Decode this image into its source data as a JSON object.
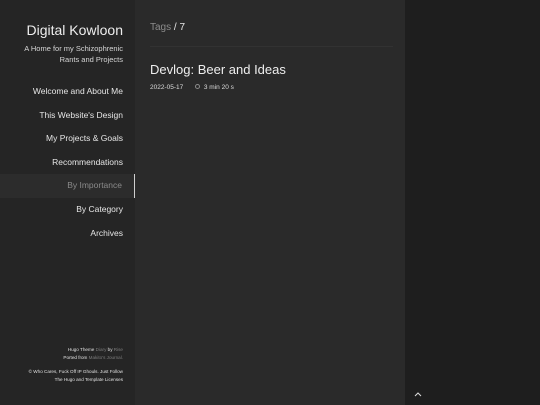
{
  "site": {
    "title": "Digital Kowloon",
    "subtitle": "A Home for my Schizophrenic Rants and Projects"
  },
  "nav": {
    "items": [
      {
        "label": "Welcome and About Me"
      },
      {
        "label": "This Website's Design"
      },
      {
        "label": "My Projects & Goals"
      },
      {
        "label": "Recommendations"
      },
      {
        "label": "By Importance"
      },
      {
        "label": "By Category"
      },
      {
        "label": "Archives"
      }
    ],
    "active_label": "By Importance"
  },
  "footer": {
    "theme_prefix": "Hugo Theme",
    "theme_name": "Diary",
    "theme_by": "by",
    "theme_author": "Rise",
    "ported_prefix": "Ported from",
    "ported_source": "Makito's Journal.",
    "license_line1": "© Who Cares, Fuck Off IP Ghouls. Just Follow",
    "license_line2": "The Hugo and Template Licenses"
  },
  "page": {
    "header_prefix": "Tags",
    "header_separator": "/",
    "header_count": "7"
  },
  "posts": [
    {
      "title": "Devlog: Beer and Ideas",
      "date": "2022-05-17",
      "reading_time": "3 min 20 s"
    }
  ],
  "icons": {
    "reading_time": "clock-icon",
    "back_to_top": "chevron-up-icon"
  },
  "colors": {
    "background": "#1e1e1e",
    "sidebar": "#252525",
    "main": "#2a2a2a",
    "text": "#eeeeee",
    "muted": "#8c8c8c"
  }
}
